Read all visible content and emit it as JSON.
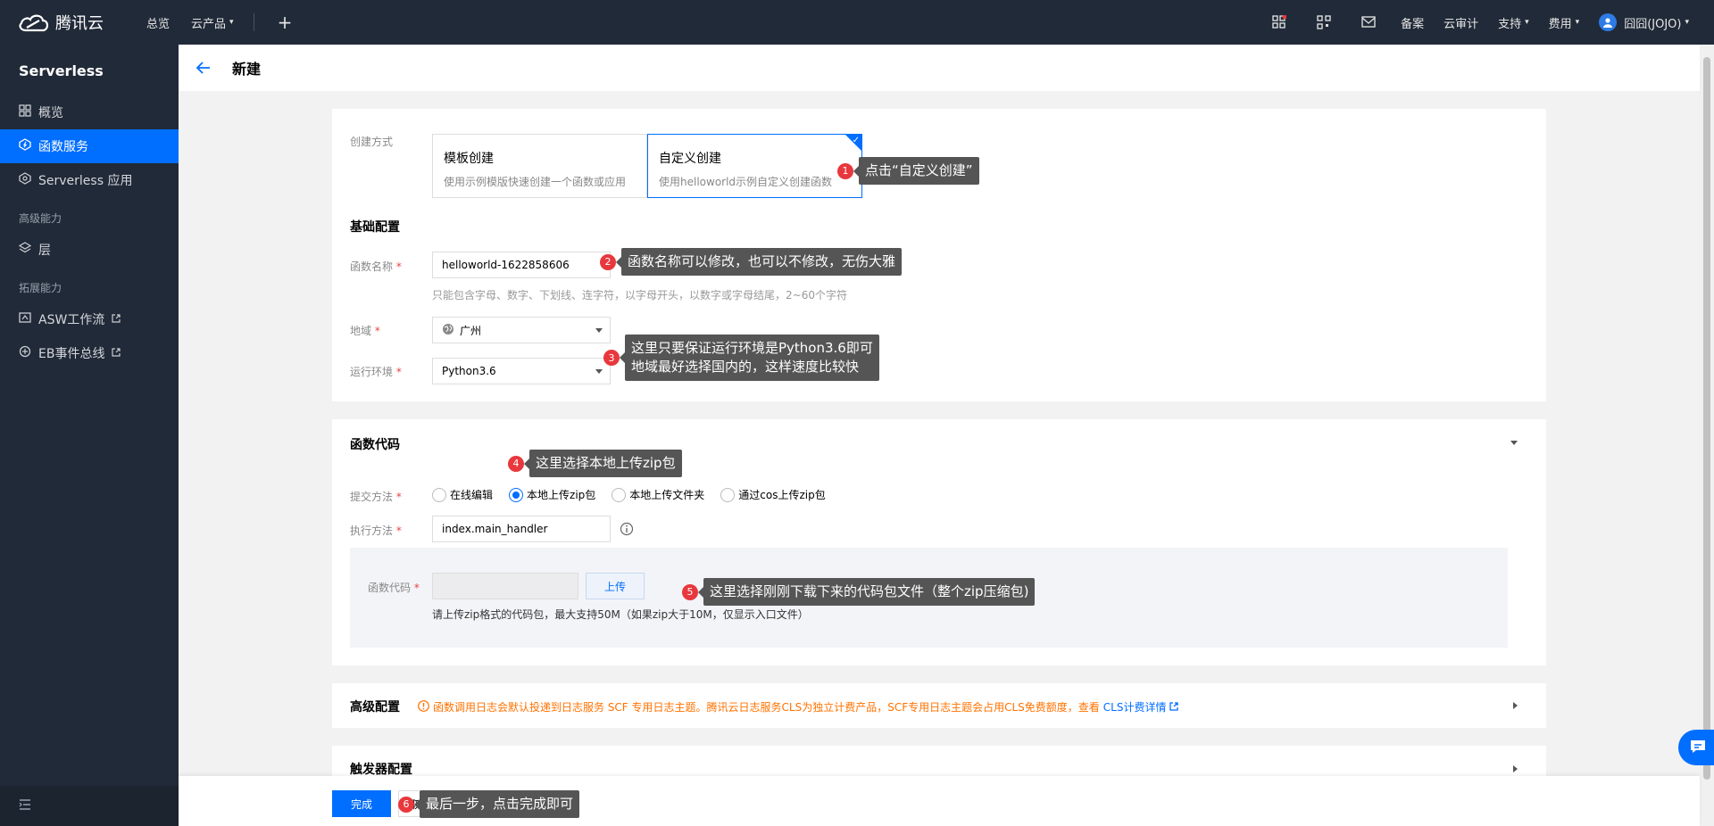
{
  "topbar": {
    "brand": "腾讯云",
    "nav": [
      "总览",
      "云产品"
    ],
    "plus": "+",
    "right_links": [
      "备案",
      "云审计",
      "支持",
      "费用"
    ],
    "user": "囧囧(JOJO)"
  },
  "sidebar": {
    "title": "Serverless",
    "items": [
      {
        "label": "概览"
      },
      {
        "label": "函数服务"
      },
      {
        "label": "Serverless 应用"
      }
    ],
    "group_advanced": "高级能力",
    "advanced_items": [
      {
        "label": "层"
      }
    ],
    "group_ext": "拓展能力",
    "ext_items": [
      {
        "label": "ASW工作流"
      },
      {
        "label": "EB事件总线"
      }
    ]
  },
  "header": {
    "title": "新建"
  },
  "create_mode": {
    "label": "创建方式",
    "options": [
      {
        "title": "模板创建",
        "desc": "使用示例模版快速创建一个函数或应用"
      },
      {
        "title": "自定义创建",
        "desc": "使用helloworld示例自定义创建函数"
      }
    ]
  },
  "basic": {
    "title": "基础配置",
    "name_label": "函数名称",
    "name_value": "helloworld-1622858606",
    "name_hint": "只能包含字母、数字、下划线、连字符，以字母开头，以数字或字母结尾，2~60个字符",
    "region_label": "地域",
    "region_value": "广州",
    "runtime_label": "运行环境",
    "runtime_value": "Python3.6"
  },
  "code": {
    "title": "函数代码",
    "submit_label": "提交方法",
    "submit_options": [
      "在线编辑",
      "本地上传zip包",
      "本地上传文件夹",
      "通过cos上传zip包"
    ],
    "exec_label": "执行方法",
    "exec_value": "index.main_handler",
    "code_label": "函数代码",
    "upload_label": "上传",
    "upload_hint": "请上传zip格式的代码包，最大支持50M（如果zip大于10M，仅显示入口文件）"
  },
  "advanced": {
    "title": "高级配置",
    "notice": "函数调用日志会默认投递到日志服务 SCF 专用日志主题。腾讯云日志服务CLS为独立计费产品，SCF专用日志主题会占用CLS免费额度，查看",
    "link": "CLS计费详情"
  },
  "trigger": {
    "title": "触发器配置"
  },
  "actions": {
    "done": "完成",
    "cancel": "取消"
  },
  "annotations": [
    {
      "num": "1",
      "text": "点击“自定义创建”"
    },
    {
      "num": "2",
      "text": "函数名称可以修改，也可以不修改，无伤大雅"
    },
    {
      "num": "3",
      "text": "这里只要保证运行环境是Python3.6即可\n地域最好选择国内的，这样速度比较快"
    },
    {
      "num": "4",
      "text": "这里选择本地上传zip包"
    },
    {
      "num": "5",
      "text": "这里选择刚刚下载下来的代码包文件（整个zip压缩包)"
    },
    {
      "num": "6",
      "text": "最后一步，点击完成即可"
    }
  ],
  "colors": {
    "accent": "#006eff",
    "dark": "#212a38",
    "annotation": "#555555",
    "badge": "#e8383d",
    "warning": "#ff7200"
  }
}
